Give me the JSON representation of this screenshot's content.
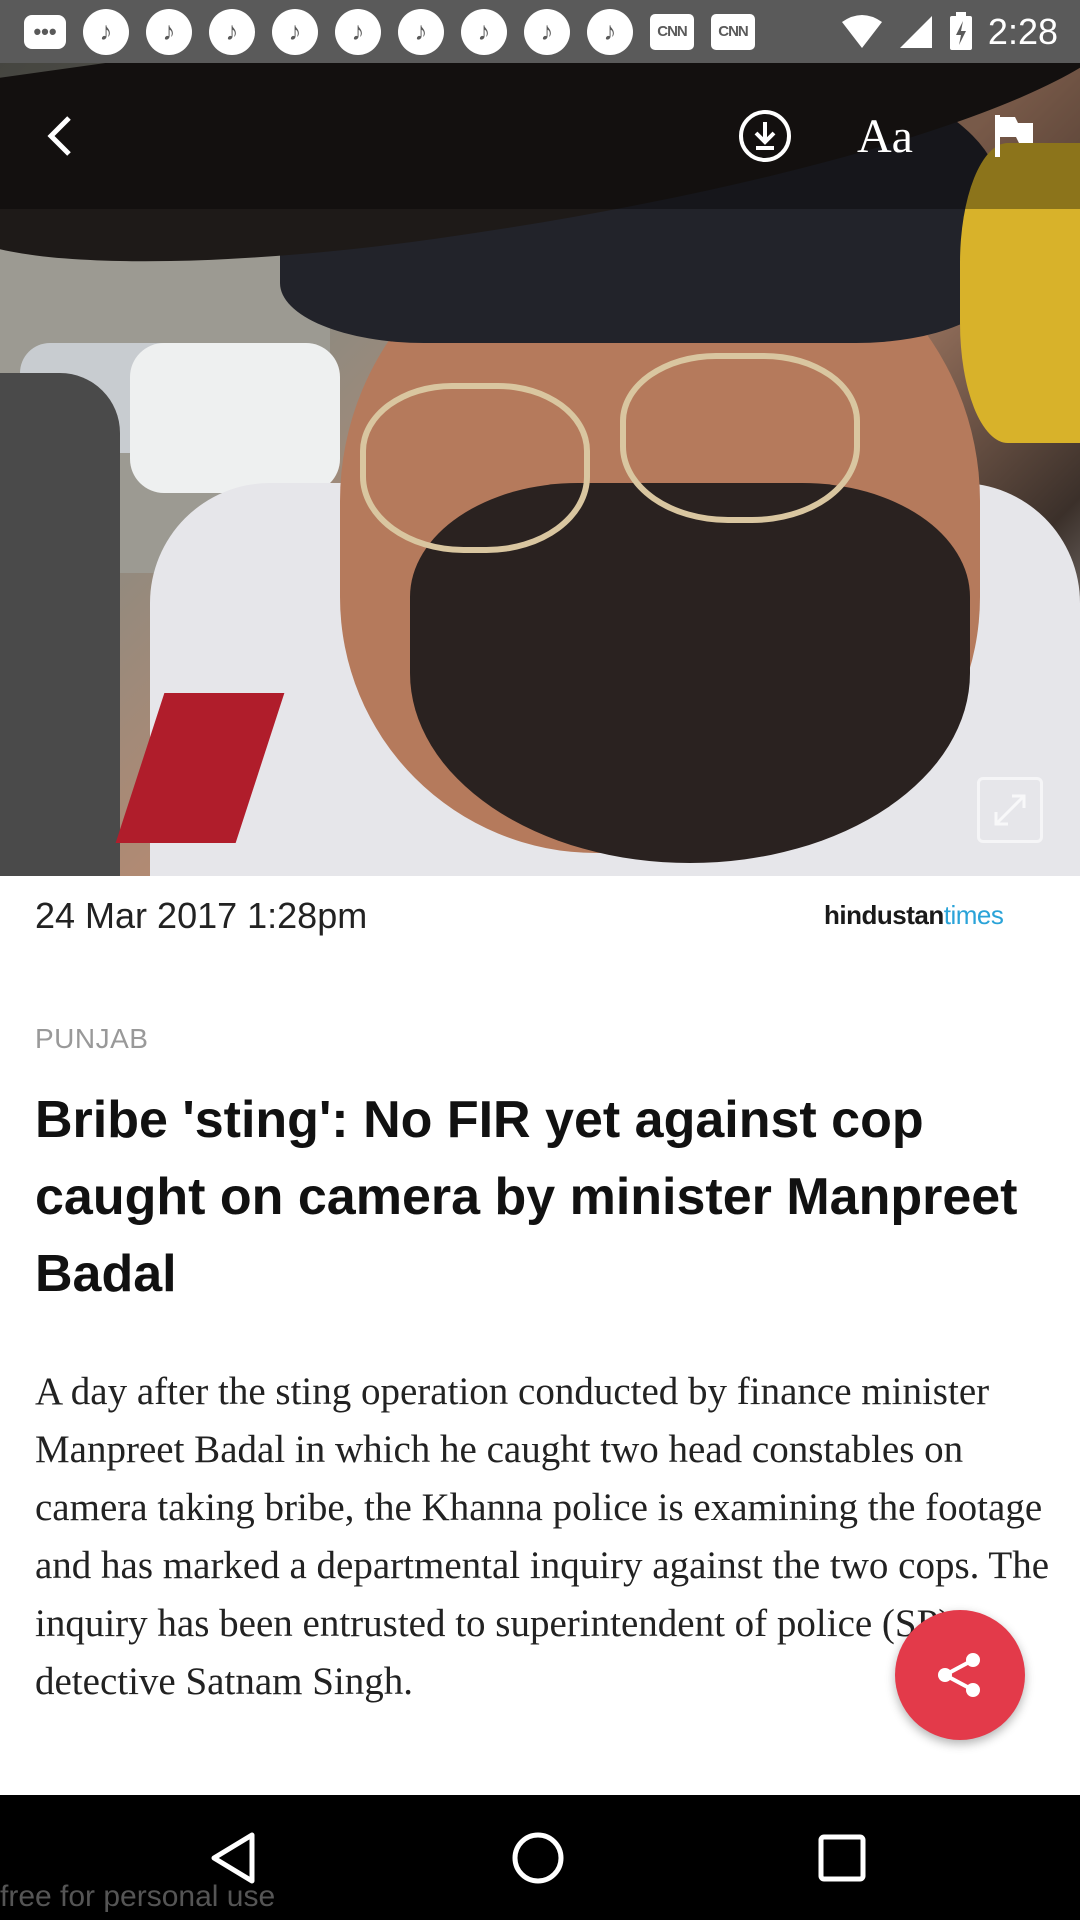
{
  "status_bar": {
    "time": "2:28",
    "notification_icons": [
      "message-icon",
      "music-icon",
      "music-icon",
      "music-icon",
      "music-icon",
      "music-icon",
      "music-icon",
      "music-icon",
      "music-icon",
      "music-icon",
      "cnn-icon",
      "cnn-icon"
    ],
    "cnn_text": "CNN"
  },
  "toolbar": {
    "font_size_label": "Aa"
  },
  "article": {
    "date": "24 Mar 2017 1:28pm",
    "brand_part1": "hindustan",
    "brand_part2": "times",
    "section": "PUNJAB",
    "headline": "Bribe 'sting': No FIR yet against cop caught on camera by minister Manpreet Badal",
    "body": "A day after the sting operation conducted by finance minister Manpreet Badal in which he caught two head constables on camera taking bribe, the Khanna police is examining the footage and has marked a departmental inquiry against the two cops. The inquiry has been entrusted to superintendent of police (SP), detective Satnam Singh."
  },
  "watermark": "free for personal use",
  "colors": {
    "status_bar": "#5a5a5a",
    "fab": "#e33a4a",
    "brand_accent": "#2aa3d8",
    "section": "#999999"
  }
}
